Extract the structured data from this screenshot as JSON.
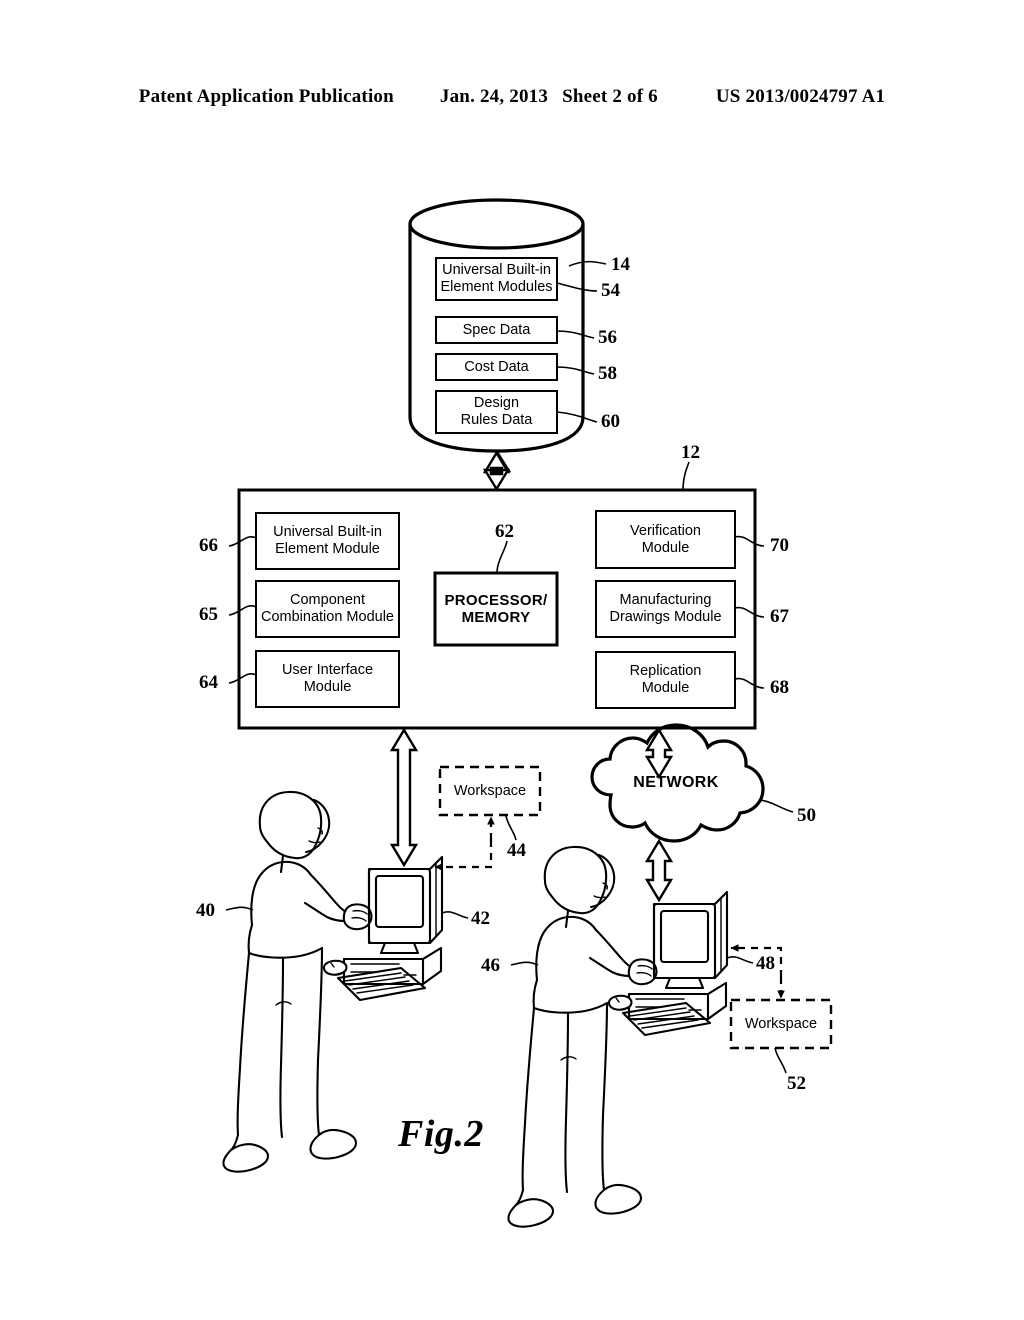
{
  "header": {
    "publication": "Patent Application Publication",
    "date": "Jan. 24, 2013",
    "sheet": "Sheet 2 of 6",
    "patent_number": "US 2013/0024797 A1"
  },
  "figure": {
    "caption": "Fig.2"
  },
  "database": {
    "ref": "14",
    "items": [
      {
        "label": "Universal Built-in\nElement Modules",
        "ref": "54"
      },
      {
        "label": "Spec Data",
        "ref": "56"
      },
      {
        "label": "Cost Data",
        "ref": "58"
      },
      {
        "label": "Design\nRules Data",
        "ref": "60"
      }
    ]
  },
  "system": {
    "ref": "12",
    "processor": {
      "label": "PROCESSOR/\nMEMORY",
      "ref": "62"
    },
    "left_modules": [
      {
        "label": "Universal Built-in\nElement Module",
        "ref": "66"
      },
      {
        "label": "Component\nCombination Module",
        "ref": "65"
      },
      {
        "label": "User Interface\nModule",
        "ref": "64"
      }
    ],
    "right_modules": [
      {
        "label": "Verification\nModule",
        "ref": "70"
      },
      {
        "label": "Manufacturing\nDrawings Module",
        "ref": "67"
      },
      {
        "label": "Replication\nModule",
        "ref": "68"
      }
    ]
  },
  "network": {
    "label": "NETWORK",
    "ref": "50"
  },
  "workspaces": [
    {
      "label": "Workspace",
      "ref": "44"
    },
    {
      "label": "Workspace",
      "ref": "52"
    }
  ],
  "users": [
    {
      "ref": "40",
      "computer_ref": "42"
    },
    {
      "ref": "46",
      "computer_ref": "48"
    }
  ]
}
